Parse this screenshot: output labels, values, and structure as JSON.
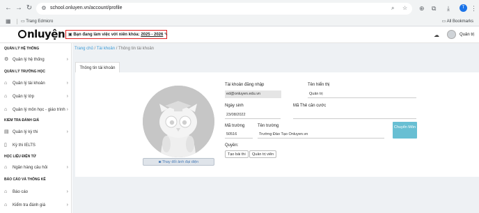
{
  "browser": {
    "url": "school.onluyen.vn/account/profile",
    "profile_initial": "T",
    "bookmarks": {
      "item": "Trang Edmicro",
      "all": "All Bookmarks"
    }
  },
  "header": {
    "logo": "nluyện",
    "year_label": "Bạn đang làm việc với niên khóa:",
    "year_value": "2025 - 2026",
    "user": "Quản trị"
  },
  "sidebar": {
    "sections": [
      {
        "title": "QUẢN LÝ HỆ THỐNG",
        "items": [
          {
            "label": "Quản lý hệ thống",
            "icon": "gears-icon"
          }
        ]
      },
      {
        "title": "QUẢN LÝ TRƯỜNG HỌC",
        "items": [
          {
            "label": "Quản lý tài khoản",
            "icon": "bank-icon"
          },
          {
            "label": "Quản lý lớp",
            "icon": "bank-icon"
          },
          {
            "label": "Quản lý môn học - giáo trình",
            "icon": "bank-icon"
          }
        ]
      },
      {
        "title": "KIỂM TRA ĐÁNH GIÁ",
        "items": [
          {
            "label": "Quản lý kỳ thi",
            "icon": "book-icon"
          },
          {
            "label": "Kỳ thi IELTS",
            "icon": "file-icon"
          }
        ]
      },
      {
        "title": "HỌC LIỆU ĐIỆN TỬ",
        "items": [
          {
            "label": "Ngân hàng câu hỏi",
            "icon": "bank-icon"
          }
        ]
      },
      {
        "title": "BÁO CÁO VÀ THỐNG KÊ",
        "items": [
          {
            "label": "Báo cáo",
            "icon": "bank-icon"
          },
          {
            "label": "Kiểm tra đánh giá",
            "icon": "bank-icon"
          }
        ]
      }
    ]
  },
  "breadcrumb": {
    "home": "Trang chủ",
    "parent": "Tài khoản",
    "current": "Thông tin tài khoản"
  },
  "tab_label": "Thông tin tài khoản",
  "profile": {
    "change_photo": "Thay đổi ảnh đại diện",
    "login_label": "Tài khoản đăng nhập",
    "login_value": "ed@onluyen.edu.vn",
    "display_label": "Tên hiển thị",
    "display_value": "Quản trị",
    "dob_label": "Ngày sinh",
    "dob_value": "23/08/2022",
    "id_label": "Mã Thẻ căn cước",
    "id_value": "",
    "school_code_label": "Mã trường",
    "school_code_value": "50516",
    "school_name_label": "Tên trường",
    "school_name_value": "Trường Đào Tạo Onluyen.vn",
    "rights_label": "Quyền:",
    "rights": [
      "Tạo bài thi",
      "Quản trị viên"
    ],
    "move_button": "Chuyển Môn"
  },
  "colors": {
    "accent": "#68bfd3",
    "highlight": "#e01b1b",
    "link": "#3c9bd6"
  }
}
